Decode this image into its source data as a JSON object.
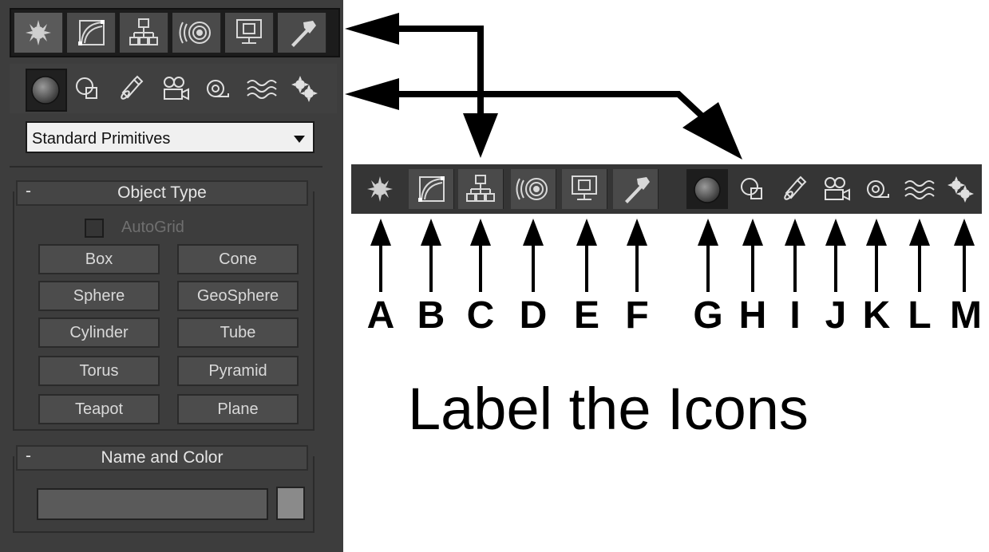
{
  "panel": {
    "tabs": [
      {
        "icon": "create-icon"
      },
      {
        "icon": "modify-icon"
      },
      {
        "icon": "hierarchy-icon"
      },
      {
        "icon": "motion-icon"
      },
      {
        "icon": "display-icon"
      },
      {
        "icon": "utilities-icon"
      }
    ],
    "subcategories": [
      {
        "icon": "geometry-icon"
      },
      {
        "icon": "shapes-icon"
      },
      {
        "icon": "lights-icon"
      },
      {
        "icon": "cameras-icon"
      },
      {
        "icon": "helpers-icon"
      },
      {
        "icon": "space-warps-icon"
      },
      {
        "icon": "systems-icon"
      }
    ],
    "dropdown_value": "Standard Primitives",
    "object_type": {
      "collapse_symbol": "-",
      "title": "Object Type",
      "autogrid_label": "AutoGrid",
      "buttons": [
        "Box",
        "Cone",
        "Sphere",
        "GeoSphere",
        "Cylinder",
        "Tube",
        "Torus",
        "Pyramid",
        "Teapot",
        "Plane"
      ]
    },
    "name_and_color": {
      "collapse_symbol": "-",
      "title": "Name and Color",
      "name_value": "",
      "swatch_color": "#8a8a8a"
    }
  },
  "strip": {
    "icons": [
      "create-icon",
      "modify-icon",
      "hierarchy-icon",
      "motion-icon",
      "display-icon",
      "utilities-icon",
      "geometry-icon",
      "shapes-icon",
      "lights-icon",
      "cameras-icon",
      "helpers-icon",
      "space-warps-icon",
      "systems-icon"
    ]
  },
  "labels": [
    "A",
    "B",
    "C",
    "D",
    "E",
    "F",
    "G",
    "H",
    "I",
    "J",
    "K",
    "L",
    "M"
  ],
  "headline": "Label the Icons",
  "colors": {
    "panel_bg": "#3d3d3d",
    "strip_bg": "#353535",
    "arrow": "#000000"
  }
}
